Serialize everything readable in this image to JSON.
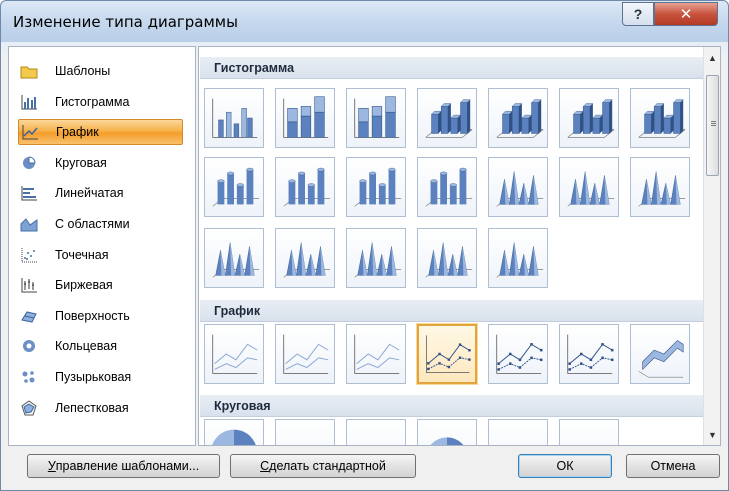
{
  "window": {
    "title": "Изменение типа диаграммы",
    "help_glyph": "?",
    "close_glyph": "✕"
  },
  "categories": [
    {
      "label": "Шаблоны",
      "icon": "folder-icon",
      "selected": false
    },
    {
      "label": "Гистограмма",
      "icon": "column-chart-icon",
      "selected": false
    },
    {
      "label": "График",
      "icon": "line-chart-icon",
      "selected": true
    },
    {
      "label": "Круговая",
      "icon": "pie-chart-icon",
      "selected": false
    },
    {
      "label": "Линейчатая",
      "icon": "bar-chart-icon",
      "selected": false
    },
    {
      "label": "С областями",
      "icon": "area-chart-icon",
      "selected": false
    },
    {
      "label": "Точечная",
      "icon": "scatter-chart-icon",
      "selected": false
    },
    {
      "label": "Биржевая",
      "icon": "stock-chart-icon",
      "selected": false
    },
    {
      "label": "Поверхность",
      "icon": "surface-chart-icon",
      "selected": false
    },
    {
      "label": "Кольцевая",
      "icon": "doughnut-chart-icon",
      "selected": false
    },
    {
      "label": "Пузырьковая",
      "icon": "bubble-chart-icon",
      "selected": false
    },
    {
      "label": "Лепестковая",
      "icon": "radar-chart-icon",
      "selected": false
    }
  ],
  "sections": [
    {
      "title": "Гистограмма"
    },
    {
      "title": "График"
    },
    {
      "title": "Круговая"
    }
  ],
  "buttons": {
    "manage_prefix": "У",
    "manage_rest": "правление шаблонами...",
    "default_prefix": "С",
    "default_rest": "делать стандартной",
    "ok": "ОК",
    "cancel": "Отмена"
  },
  "colors": {
    "accent_selected": "#f7b14a",
    "chart_blue": "#5b82be"
  }
}
